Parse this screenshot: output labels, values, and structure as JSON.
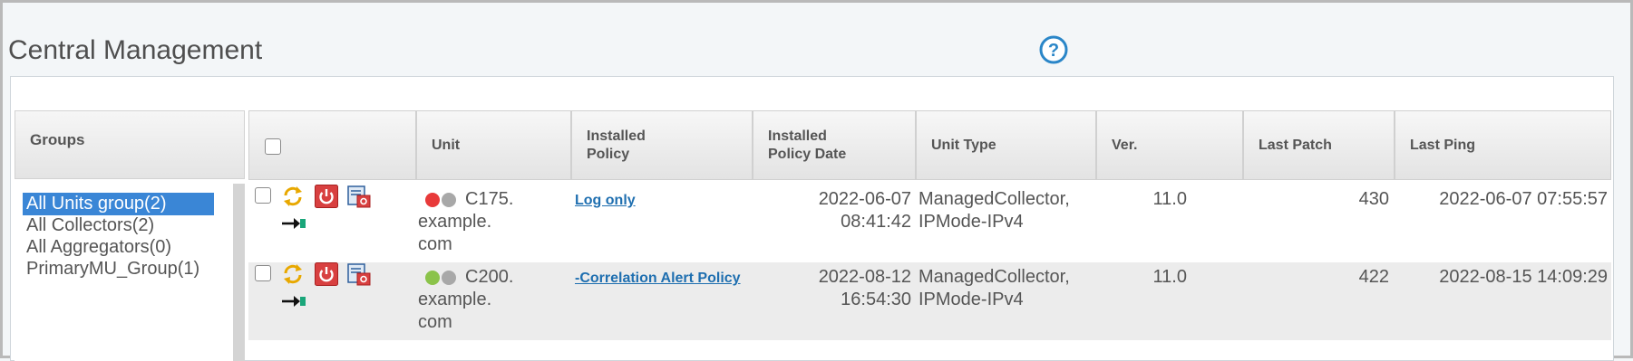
{
  "page": {
    "title": "Central Management"
  },
  "groups": {
    "header": "Groups",
    "items": [
      {
        "label": "All Units group(2)",
        "selected": true
      },
      {
        "label": "All Collectors(2)",
        "selected": false
      },
      {
        "label": "All Aggregators(0)",
        "selected": false
      },
      {
        "label": "PrimaryMU_Group(1)",
        "selected": false
      }
    ]
  },
  "table": {
    "columns": {
      "unit": "Unit",
      "installed_policy": [
        "Installed",
        "Policy"
      ],
      "installed_policy_date": [
        "Installed",
        "Policy Date"
      ],
      "unit_type": "Unit Type",
      "ver": "Ver.",
      "last_patch": "Last Patch",
      "last_ping": "Last Ping"
    },
    "rows": [
      {
        "unit_line1": "C175.",
        "unit_line2": "example.",
        "unit_line3": "com",
        "status": [
          "red",
          "gray"
        ],
        "policy": "Log only",
        "policy_date": "2022-06-07",
        "policy_time": "08:41:42",
        "unit_type_line1": "ManagedCollector,",
        "unit_type_line2": "IPMode-IPv4",
        "ver": "11.0",
        "last_patch": "430",
        "last_ping": "2022-06-07 07:55:57"
      },
      {
        "unit_line1": "C200.",
        "unit_line2": "example.",
        "unit_line3": "com",
        "status": [
          "green",
          "gray"
        ],
        "policy": "-Correlation Alert Policy",
        "policy_date": "2022-08-12",
        "policy_time": "16:54:30",
        "unit_type_line1": "ManagedCollector,",
        "unit_type_line2": "IPMode-IPv4",
        "ver": "11.0",
        "last_patch": "422",
        "last_ping": "2022-08-15 14:09:29"
      }
    ]
  },
  "colors": {
    "selected_group": "#3a86d6",
    "status_red": "#e83a3a",
    "status_green": "#8bc34a",
    "status_gray": "#a8a8a8",
    "link": "#1f6fb0"
  },
  "icons": [
    "help-icon",
    "refresh-icon",
    "power-icon",
    "config-icon",
    "follow-link-icon"
  ]
}
